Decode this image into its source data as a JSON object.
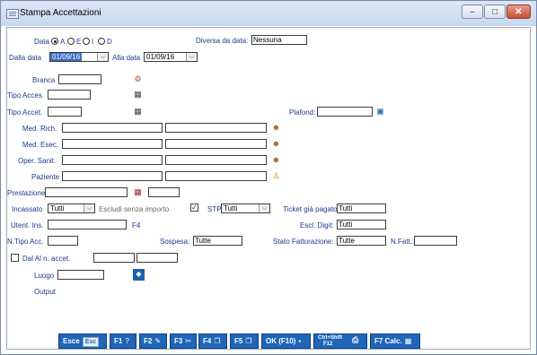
{
  "window": {
    "title": "Stampa Accettazioni",
    "controls": {
      "minimize": "‒",
      "maximize": "□",
      "close": "✕"
    }
  },
  "form": {
    "data_label": "Data",
    "radios": [
      {
        "label": "A",
        "selected": true
      },
      {
        "label": "E",
        "selected": false
      },
      {
        "label": "I",
        "selected": false
      },
      {
        "label": "D",
        "selected": false
      }
    ],
    "diversa_da_data_label": "Diversa da data:",
    "diversa_da_data_value": "Nessuna",
    "dalla_data_label": "Dalla data",
    "dalla_data_value": "01/09/16",
    "alla_data_label": "Alla data",
    "alla_data_value": "01/09/16",
    "branca_label": "Branca",
    "tipo_acces_label": "Tipo Acces.",
    "tipo_accet_label": "Tipo Accet.",
    "plafond_label": "Plafond:",
    "med_rich_label": "Med. Rich.",
    "med_esec_label": "Med. Esec.",
    "oper_sanit_label": "Oper. Sanit.",
    "paziente_label": "Paziente",
    "prestazione_label": "Prestazione",
    "incassato_label": "Incassato",
    "incassato_value": "Tutti",
    "escludi_label": "Escludi senza importo",
    "escludi_checked": true,
    "stp_label": "STP",
    "stp_value": "Tutti",
    "ticket_label": "Ticket già pagato:",
    "ticket_value": "Tutti",
    "utent_ins_label": "Utent. Ins.",
    "f4_label": "F4",
    "escl_digit_label": "Escl. Digit:",
    "escl_digit_value": "Tutti",
    "n_tipo_acc_label": "N.Tipo Acc.",
    "sospesa_label": "Sospesa:",
    "sospesa_value": "Tutte",
    "stato_fatt_label": "Stato Fatturazione:",
    "stato_fatt_value": "Tutte",
    "n_fatt_label": "N.Fatt.:",
    "dal_al_label": "Dal Al n. accet.",
    "dal_al_checked": false,
    "luogo_label": "Luogo",
    "output_label": "Output"
  },
  "toolbar": {
    "esce_label": "Esce",
    "esc_badge": "Esc",
    "f1_label": "F1",
    "f2_label": "F2",
    "f3_label": "F3",
    "f4_label": "F4",
    "f5_label": "F5",
    "ok_label": "OK (F10)",
    "ctrl_shift_label": "Ctrl+Shift",
    "f12_label": "F12",
    "f7_label": "F7 Calc."
  },
  "colors": {
    "label_text": "#1a3a8c",
    "toolbar_bg": "#1f66b8",
    "selected_field": "#3a6cc6"
  }
}
